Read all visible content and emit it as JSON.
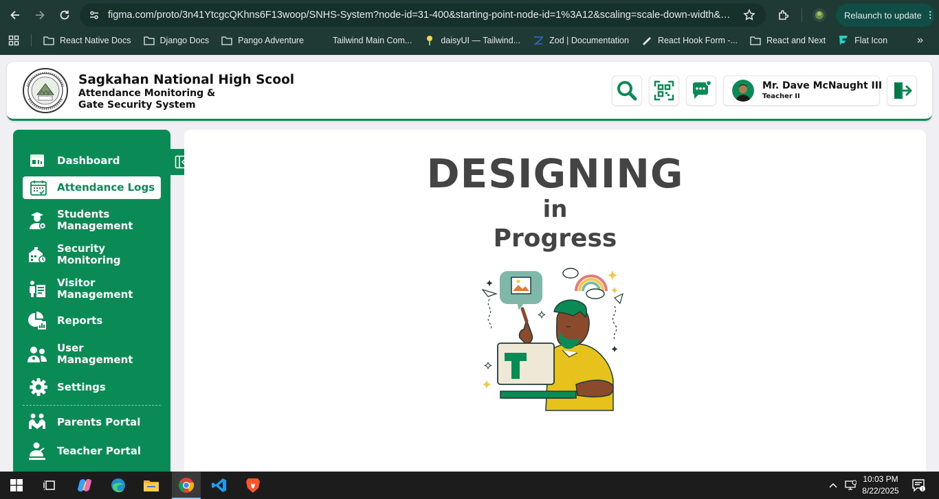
{
  "browser": {
    "url": "figma.com/proto/3n41YtcgcQKhns6F13woop/SNHS-System?node-id=31-400&starting-point-node-id=1%3A12&scaling=scale-down-width&cont...",
    "relaunch_label": "Relaunch to update",
    "relaunch_menu": "⋮",
    "bookmarks": [
      {
        "label": "React Native Docs",
        "icon": "folder-icon"
      },
      {
        "label": "Django Docs",
        "icon": "folder-icon"
      },
      {
        "label": "Pango Adventure",
        "icon": "folder-icon"
      },
      {
        "label": "Tailwind Main Com...",
        "icon": "tailwind-icon"
      },
      {
        "label": "daisyUI — Tailwind...",
        "icon": "daisyui-icon"
      },
      {
        "label": "Zod | Documentation",
        "icon": "zod-icon"
      },
      {
        "label": "React Hook Form -...",
        "icon": "rhf-icon"
      },
      {
        "label": "React and Next",
        "icon": "folder-icon"
      },
      {
        "label": "Flat Icon",
        "icon": "flaticon-icon"
      }
    ],
    "bookmarks_overflow": "»"
  },
  "header": {
    "school_name": "Sagkahan National High Scool",
    "subtitle_line1": "Attendance Monitoring &",
    "subtitle_line2": "Gate Security System",
    "user_name": "Mr. Dave McNaught III",
    "user_role": "Teacher II"
  },
  "sidebar": {
    "items": [
      {
        "label": "Dashboard",
        "icon": "dashboard-icon"
      },
      {
        "label": "Attendance Logs",
        "icon": "calendar-icon",
        "active": true
      },
      {
        "label": "Students Management",
        "icon": "student-icon"
      },
      {
        "label": "Security Monitoring",
        "icon": "security-icon"
      },
      {
        "label": "Visitor Management",
        "icon": "visitor-icon"
      },
      {
        "label": "Reports",
        "icon": "reports-icon"
      },
      {
        "label": "User Management",
        "icon": "users-icon"
      },
      {
        "label": "Settings",
        "icon": "gear-icon"
      }
    ],
    "portals": [
      {
        "label": "Parents Portal",
        "icon": "parents-icon"
      },
      {
        "label": "Teacher Portal",
        "icon": "teacher-icon"
      }
    ]
  },
  "main": {
    "line1": "DESIGNING",
    "line2": "in",
    "line3": "Progress"
  },
  "taskbar": {
    "time": "10:03 PM",
    "date": "8/22/2025"
  },
  "colors": {
    "brand_green": "#0a8a55",
    "chrome_bg": "#1f3a34"
  }
}
